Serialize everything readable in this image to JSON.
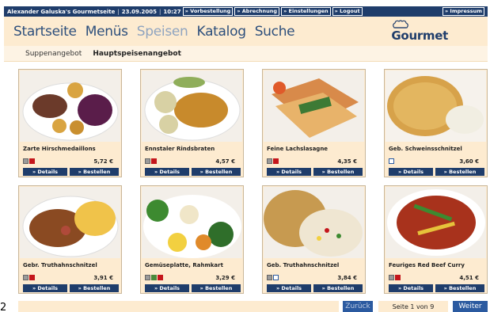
{
  "topbar": {
    "site_title": "Alexander Galuska's Gourmetseite",
    "date": "23.09.2005",
    "time": "10:27",
    "links": [
      "» Vorbestellung",
      "» Abrechnung",
      "» Einstellungen",
      "» Logout"
    ],
    "impressum": "» Impressum"
  },
  "mainnav": {
    "items": [
      "Startseite",
      "Menüs",
      "Speisen",
      "Katalog",
      "Suche"
    ],
    "active": "Speisen"
  },
  "logo": {
    "hat": "ççç",
    "word": "Gourmet"
  },
  "subnav": {
    "items": [
      "Suppenangebot",
      "Hauptspeisenangebot"
    ],
    "active": "Hauptspeisenangebot"
  },
  "buttons": {
    "details": "» Details",
    "order": "» Bestellen"
  },
  "dishes": [
    {
      "name": "Zarte Hirschmedaillons",
      "price": "5,72 €",
      "icons": [
        "grey-icon",
        "heart-icon"
      ]
    },
    {
      "name": "Ennstaler Rindsbraten",
      "price": "4,57 €",
      "icons": [
        "grey-icon",
        "heart-icon"
      ]
    },
    {
      "name": "Feine Lachslasagne",
      "price": "4,35 €",
      "icons": [
        "grey-icon",
        "heart-icon"
      ]
    },
    {
      "name": "Geb. Schweinsschnitzel",
      "price": "3,60 €",
      "icons": [
        "blue-icon"
      ]
    },
    {
      "name": "Gebr. Truthahnschnitzel",
      "price": "3,91 €",
      "icons": [
        "grey-icon",
        "heart-icon"
      ]
    },
    {
      "name": "Gemüseplatte, Rahmkart",
      "price": "3,29 €",
      "icons": [
        "grey-icon",
        "green-icon",
        "heart-icon"
      ]
    },
    {
      "name": "Geb. Truthahnschnitzel",
      "price": "3,84 €",
      "icons": [
        "grey-icon",
        "blue-icon"
      ]
    },
    {
      "name": "Feuriges Red Beef Curry",
      "price": "4,51 €",
      "icons": [
        "grey-icon",
        "heart-icon"
      ]
    }
  ],
  "pagination": {
    "prev": "Zurück",
    "info": "Seite 1 von 9",
    "next": "Weiter"
  },
  "left_digit": "2",
  "colors": {
    "navy": "#1f3d6b",
    "accent_blue": "#2b5aa0",
    "cream": "#fdebd0",
    "heart_red": "#c4161c"
  }
}
